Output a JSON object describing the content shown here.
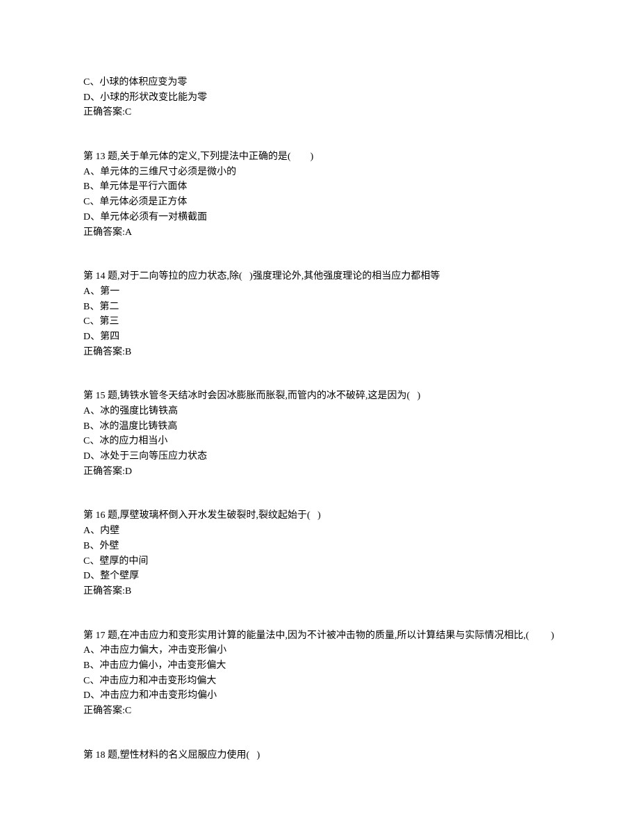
{
  "preamble": {
    "c": "C、小球的体积应变为零",
    "d": "D、小球的形状改变比能为零",
    "answer_label": "正确答案:C"
  },
  "q13": {
    "title": "第 13 题,关于单元体的定义,下列提法中正确的是(        )",
    "a": "A、单元体的三维尺寸必须是微小的",
    "b": "B、单元体是平行六面体",
    "c": "C、单元体必须是正方体",
    "d": "D、单元体必须有一对横截面",
    "answer_label": "正确答案:A"
  },
  "q14": {
    "title": "第 14 题,对于二向等拉的应力状态,除(   )强度理论外,其他强度理论的相当应力都相等",
    "a": "A、第一",
    "b": "B、第二",
    "c": "C、第三",
    "d": "D、第四",
    "answer_label": "正确答案:B"
  },
  "q15": {
    "title": "第 15 题,铸铁水管冬天结冰时会因冰膨胀而胀裂,而管内的冰不破碎,这是因为(   )",
    "a": "A、冰的强度比铸铁高",
    "b": "B、冰的温度比铸铁高",
    "c": "C、冰的应力相当小",
    "d": "D、冰处于三向等压应力状态",
    "answer_label": "正确答案:D"
  },
  "q16": {
    "title": "第 16 题,厚壁玻璃杯倒入开水发生破裂时,裂纹起始于(   )",
    "a": "A、内壁",
    "b": "B、外壁",
    "c": "C、壁厚的中间",
    "d": "D、整个壁厚",
    "answer_label": "正确答案:B"
  },
  "q17": {
    "title": "第 17 题,在冲击应力和变形实用计算的能量法中,因为不计被冲击物的质量,所以计算结果与实际情况相比,(         )",
    "a": "A、冲击应力偏大，冲击变形偏小",
    "b": "B、冲击应力偏小，冲击变形偏大",
    "c": "C、冲击应力和冲击变形均偏大",
    "d": "D、冲击应力和冲击变形均偏小",
    "answer_label": "正确答案:C"
  },
  "q18": {
    "title": "第 18 题,塑性材料的名义屈服应力使用(   )"
  }
}
